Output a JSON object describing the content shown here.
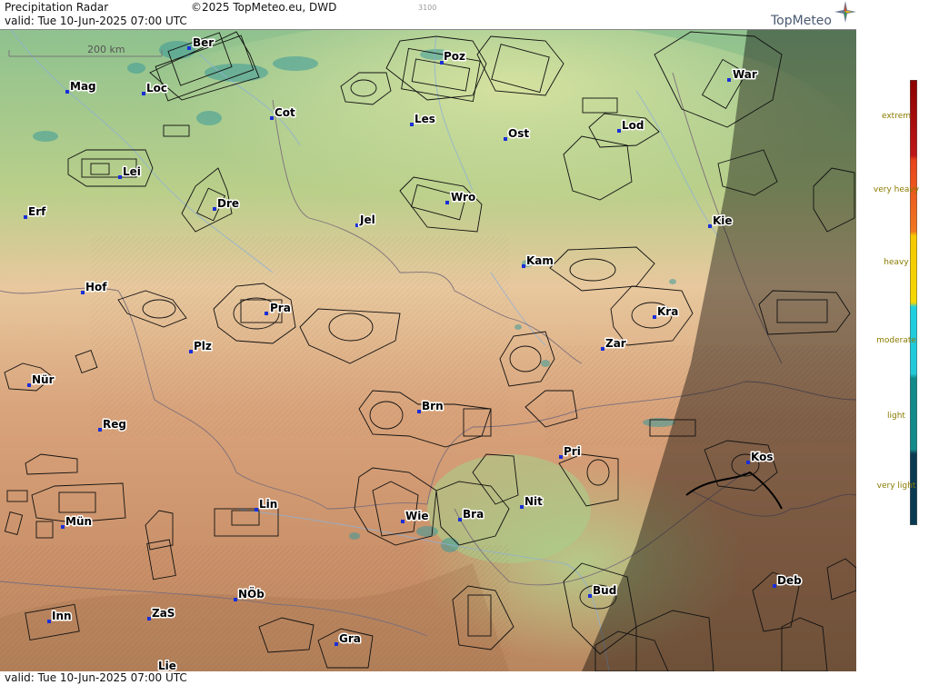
{
  "header": {
    "title": "Precipitation Radar",
    "copyright": "©2025 TopMeteo.eu, DWD",
    "code": "3100",
    "valid": "valid:  Tue  10-Jun-2025 07:00 UTC",
    "logo": "TopMeteo"
  },
  "footer": {
    "valid": "valid:  Tue  10-Jun-2025 07:00 UTC"
  },
  "scale": {
    "label": "200 km"
  },
  "cities": {
    "ber": "Ber",
    "poz": "Poz",
    "war": "War",
    "mag": "Mag",
    "loc": "Loc",
    "cot": "Cot",
    "les": "Les",
    "ost": "Ost",
    "lod": "Lod",
    "lei": "Lei",
    "dre": "Dre",
    "wro": "Wro",
    "erf": "Erf",
    "jel": "Jel",
    "kie": "Kie",
    "kam": "Kam",
    "hof": "Hof",
    "pra": "Pra",
    "kra": "Kra",
    "plz": "Plz",
    "zar": "Zar",
    "nur": "Nür",
    "brn": "Brn",
    "reg": "Reg",
    "pri": "Pri",
    "kos": "Kos",
    "lin": "Lin",
    "nit": "Nit",
    "wie": "Wie",
    "bra": "Bra",
    "mun": "Mün",
    "deb": "Deb",
    "bud": "Bud",
    "nob": "NÖb",
    "inn": "Inn",
    "zas": "ZaS",
    "gra": "Gra",
    "lie": "Lie"
  },
  "legend": {
    "extreme": "extrem",
    "very_heavy": "very heavy",
    "heavy": "heavy",
    "moderate": "moderate",
    "light": "light",
    "very_light": "very light",
    "colors": [
      "#8b0000",
      "#e8431a",
      "#f5c800",
      "#1ed0e0",
      "#138a8a",
      "#0a3a52"
    ]
  }
}
